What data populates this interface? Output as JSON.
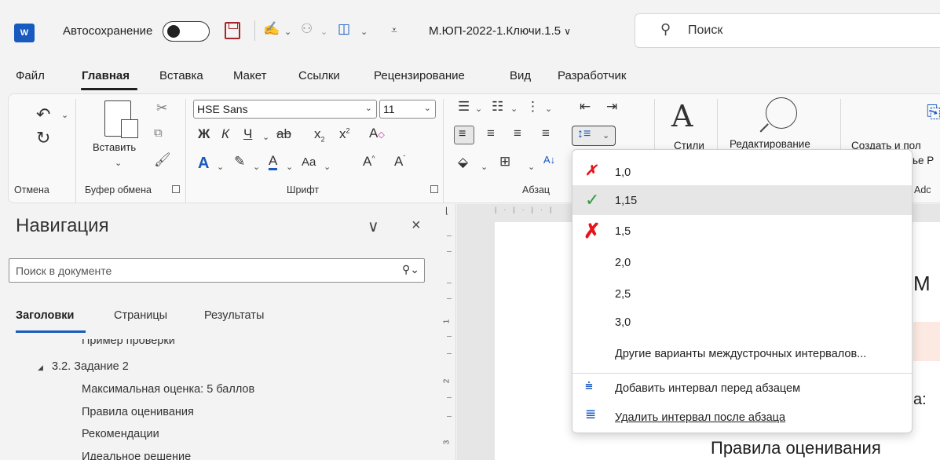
{
  "titlebar": {
    "app_icon": "W",
    "autosave_label": "Автосохранение",
    "doc_title": "М.ЮП-2022-1.Ключи.1.5",
    "doc_title_chevron": "∨",
    "search_placeholder": "Поиск"
  },
  "tabs": [
    "Файл",
    "Главная",
    "Вставка",
    "Макет",
    "Ссылки",
    "Рецензирование",
    "Вид",
    "Разработчик"
  ],
  "ribbon": {
    "undo": {
      "label": "Отмена"
    },
    "clipboard": {
      "paste_label": "Вставить",
      "group_label": "Буфер обмена"
    },
    "font": {
      "family": "HSE Sans",
      "size": "11",
      "group_label": "Шрифт",
      "aa_label": "Aa"
    },
    "paragraph": {
      "group_label": "Абзац"
    },
    "styles": {
      "label": "Стили"
    },
    "editing": {
      "label": "Редактирование"
    },
    "create": {
      "label": "Создать и пол",
      "label2": "ье P",
      "adobe_label": "Adc"
    }
  },
  "navigation": {
    "title": "Навигация",
    "search_placeholder": "Поиск в документе",
    "tabs": [
      "Заголовки",
      "Страницы",
      "Результаты"
    ],
    "items": [
      {
        "text": "Пример проверки",
        "level": 2
      },
      {
        "text": "3.2. Задание 2",
        "level": 1,
        "expanded": true
      },
      {
        "text": "Максимальная оценка: 5 баллов",
        "level": 2
      },
      {
        "text": "Правила оценивания",
        "level": 2
      },
      {
        "text": "Рекомендации",
        "level": 2
      },
      {
        "text": "Идеальное решение",
        "level": 2
      }
    ]
  },
  "ruler": {
    "numbers": [
      "1",
      "2",
      "3"
    ]
  },
  "document": {
    "heading_fragment": "М",
    "text_fragment": "а:",
    "section_heading": "Правила оценивания"
  },
  "line_spacing_menu": {
    "options": [
      {
        "value": "1,0",
        "mark": "red-x",
        "selected": false
      },
      {
        "value": "1,15",
        "mark": "green-check",
        "selected": true
      },
      {
        "value": "1,5",
        "mark": "red-x",
        "selected": false
      },
      {
        "value": "2,0",
        "mark": "",
        "selected": false
      },
      {
        "value": "2,5",
        "mark": "",
        "selected": false
      },
      {
        "value": "3,0",
        "mark": "",
        "selected": false
      }
    ],
    "other_options": "Другие варианты междустрочных интервалов...",
    "add_before": "Добавить интервал перед абзацем",
    "remove_after": "Удалить интервал после абзаца"
  },
  "colors": {
    "word_blue": "#185abd",
    "save_red": "#a4262c",
    "x_red": "#e8141c",
    "check_green": "#2e9e3f",
    "nav_underline": "#185abd"
  }
}
